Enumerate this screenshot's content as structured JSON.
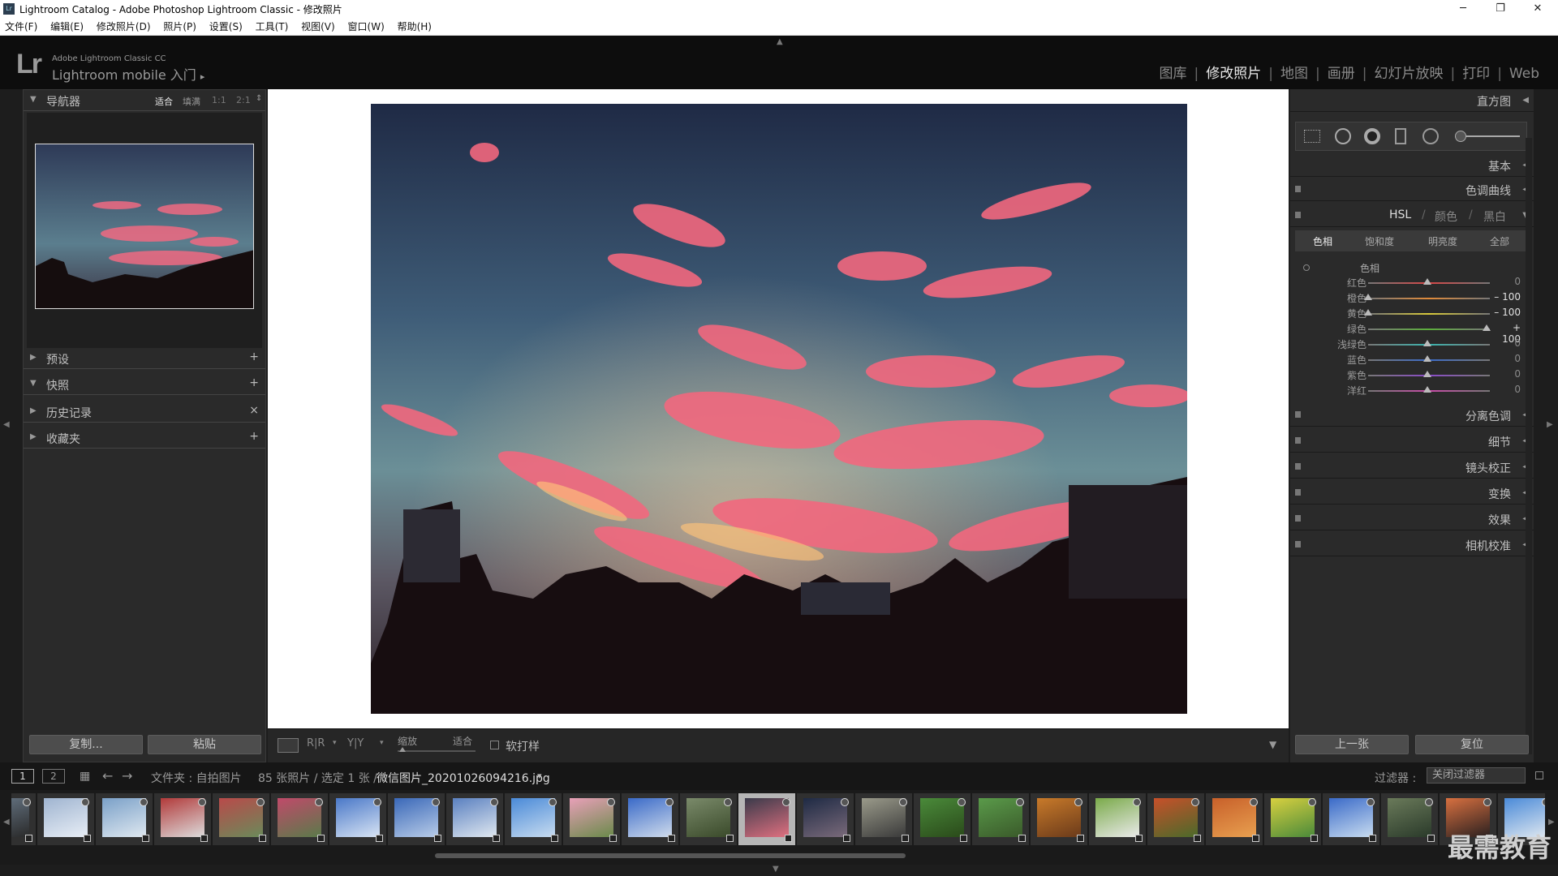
{
  "window": {
    "title": "Lightroom Catalog - Adobe Photoshop Lightroom Classic - 修改照片",
    "app_icon": "Lr",
    "minimize": "─",
    "maximize": "❐",
    "close": "✕"
  },
  "menu": [
    "文件(F)",
    "编辑(E)",
    "修改照片(D)",
    "照片(P)",
    "设置(S)",
    "工具(T)",
    "视图(V)",
    "窗口(W)",
    "帮助(H)"
  ],
  "identity": {
    "logo": "Lr",
    "line1": "Adobe Lightroom Classic CC",
    "line2": "Lightroom mobile 入门",
    "arrow": "▸"
  },
  "modules": {
    "items": [
      "图库",
      "修改照片",
      "地图",
      "画册",
      "幻灯片放映",
      "打印",
      "Web"
    ],
    "separator": "|",
    "active": "修改照片"
  },
  "left_panel": {
    "navigator": {
      "title": "导航器",
      "zoom_options": [
        "适合",
        "填满",
        "1:1",
        "2:1"
      ],
      "zoom_selected": "适合"
    },
    "sections": [
      {
        "label": "预设",
        "action": "+"
      },
      {
        "label": "快照",
        "action": "+"
      },
      {
        "label": "历史记录",
        "action": "×"
      },
      {
        "label": "收藏夹",
        "action": "+"
      }
    ],
    "copy_button": "复制...",
    "paste_button": "粘贴"
  },
  "right_panel": {
    "histogram": "直方图",
    "basic": "基本",
    "tone_curve": "色调曲线",
    "hsl": {
      "tabs": [
        "HSL",
        "颜色",
        "黑白"
      ],
      "separators": [
        "/",
        "/"
      ],
      "subtabs": [
        "色相",
        "饱和度",
        "明亮度",
        "全部"
      ],
      "group_title": "色相",
      "rows": [
        {
          "name": "红色",
          "value": "0",
          "pos": 0.5,
          "color": "#d64848"
        },
        {
          "name": "橙色",
          "value": "– 100",
          "pos": 0.0,
          "color": "#e08a3a"
        },
        {
          "name": "黄色",
          "value": "– 100",
          "pos": 0.0,
          "color": "#d8c93a"
        },
        {
          "name": "绿色",
          "value": "+ 100",
          "pos": 1.0,
          "color": "#5cae3c"
        },
        {
          "name": "浅绿色",
          "value": "0",
          "pos": 0.5,
          "color": "#3cb4ae"
        },
        {
          "name": "蓝色",
          "value": "0",
          "pos": 0.5,
          "color": "#3c6cc8"
        },
        {
          "name": "紫色",
          "value": "0",
          "pos": 0.5,
          "color": "#8a4cc8"
        },
        {
          "name": "洋红",
          "value": "0",
          "pos": 0.5,
          "color": "#c84ca8"
        }
      ]
    },
    "lower_panels": [
      "分离色调",
      "细节",
      "镜头校正",
      "变换",
      "效果",
      "相机校准"
    ],
    "prev_button": "上一张",
    "reset_button": "复位"
  },
  "toolbar": {
    "zoom_label": "缩放",
    "zoom_value": "适合",
    "soft_proof": "软打样",
    "xy1": "R|R",
    "xy2": "Y|Y"
  },
  "filmbar": {
    "page1": "1",
    "page2": "2",
    "source": "文件夹 : 自拍图片",
    "count": "85 张照片 / 选定 1 张 /",
    "filename": "微信图片_20201026094216.jpg",
    "filename_arrow": "▾",
    "filter_label": "过滤器 :",
    "filter_value": "关闭过滤器"
  },
  "watermark": "最需教育"
}
